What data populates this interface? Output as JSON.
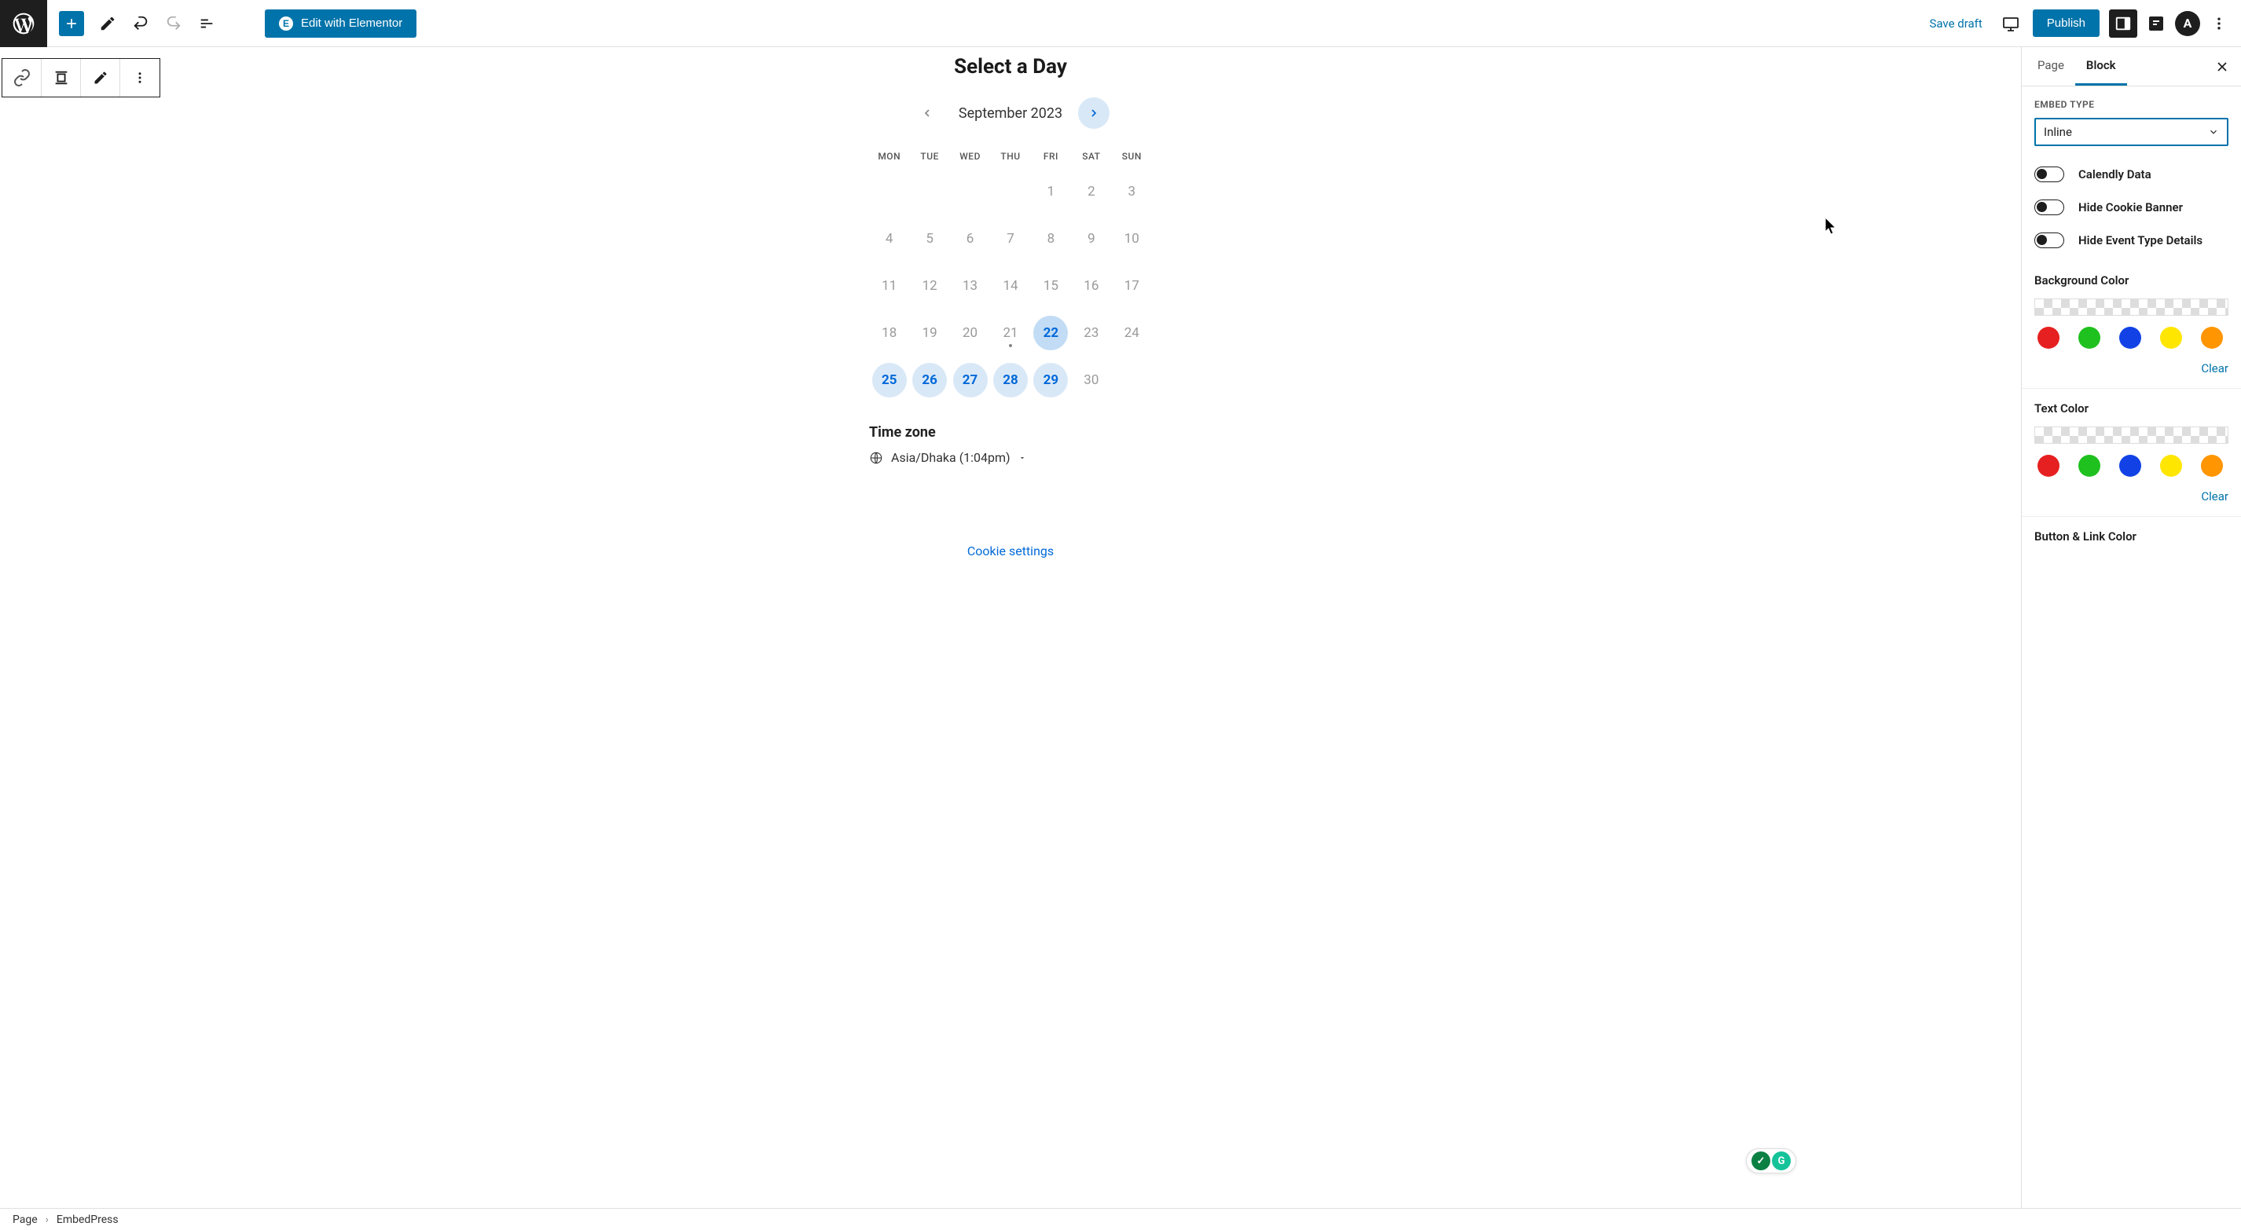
{
  "topbar": {
    "add_block": "+",
    "elementor_label": "Edit with Elementor",
    "save_draft": "Save draft",
    "publish": "Publish",
    "avatar_letter": "A"
  },
  "calendly": {
    "title": "Select a Day",
    "month": "September 2023",
    "dow": [
      "MON",
      "TUE",
      "WED",
      "THU",
      "FRI",
      "SAT",
      "SUN"
    ],
    "weeks": [
      [
        null,
        null,
        null,
        null,
        {
          "d": "1"
        },
        {
          "d": "2"
        },
        {
          "d": "3"
        }
      ],
      [
        {
          "d": "4"
        },
        {
          "d": "5"
        },
        {
          "d": "6"
        },
        {
          "d": "7"
        },
        {
          "d": "8"
        },
        {
          "d": "9"
        },
        {
          "d": "10"
        }
      ],
      [
        {
          "d": "11"
        },
        {
          "d": "12"
        },
        {
          "d": "13"
        },
        {
          "d": "14"
        },
        {
          "d": "15"
        },
        {
          "d": "16"
        },
        {
          "d": "17"
        }
      ],
      [
        {
          "d": "18"
        },
        {
          "d": "19"
        },
        {
          "d": "20"
        },
        {
          "d": "21",
          "dot": true
        },
        {
          "d": "22",
          "avail": true,
          "today": true
        },
        {
          "d": "23"
        },
        {
          "d": "24"
        }
      ],
      [
        {
          "d": "25",
          "avail": true
        },
        {
          "d": "26",
          "avail": true
        },
        {
          "d": "27",
          "avail": true
        },
        {
          "d": "28",
          "avail": true
        },
        {
          "d": "29",
          "avail": true
        },
        {
          "d": "30"
        },
        null
      ]
    ],
    "tz_label": "Time zone",
    "tz_value": "Asia/Dhaka (1:04pm)",
    "cookie_link": "Cookie settings"
  },
  "sidebar": {
    "tabs": {
      "page": "Page",
      "block": "Block"
    },
    "embed_type_label": "EMBED TYPE",
    "embed_type_value": "Inline",
    "toggles": [
      {
        "label": "Calendly Data",
        "on": false
      },
      {
        "label": "Hide Cookie Banner",
        "on": false
      },
      {
        "label": "Hide Event Type Details",
        "on": false
      }
    ],
    "bg_label": "Background Color",
    "text_label": "Text Color",
    "button_link_label": "Button & Link Color",
    "swatches": [
      "#e62020",
      "#1fc11f",
      "#1242e6",
      "#ffe600",
      "#ff9500"
    ],
    "clear": "Clear"
  },
  "footer": {
    "crumb1": "Page",
    "crumb2": "EmbedPress"
  }
}
